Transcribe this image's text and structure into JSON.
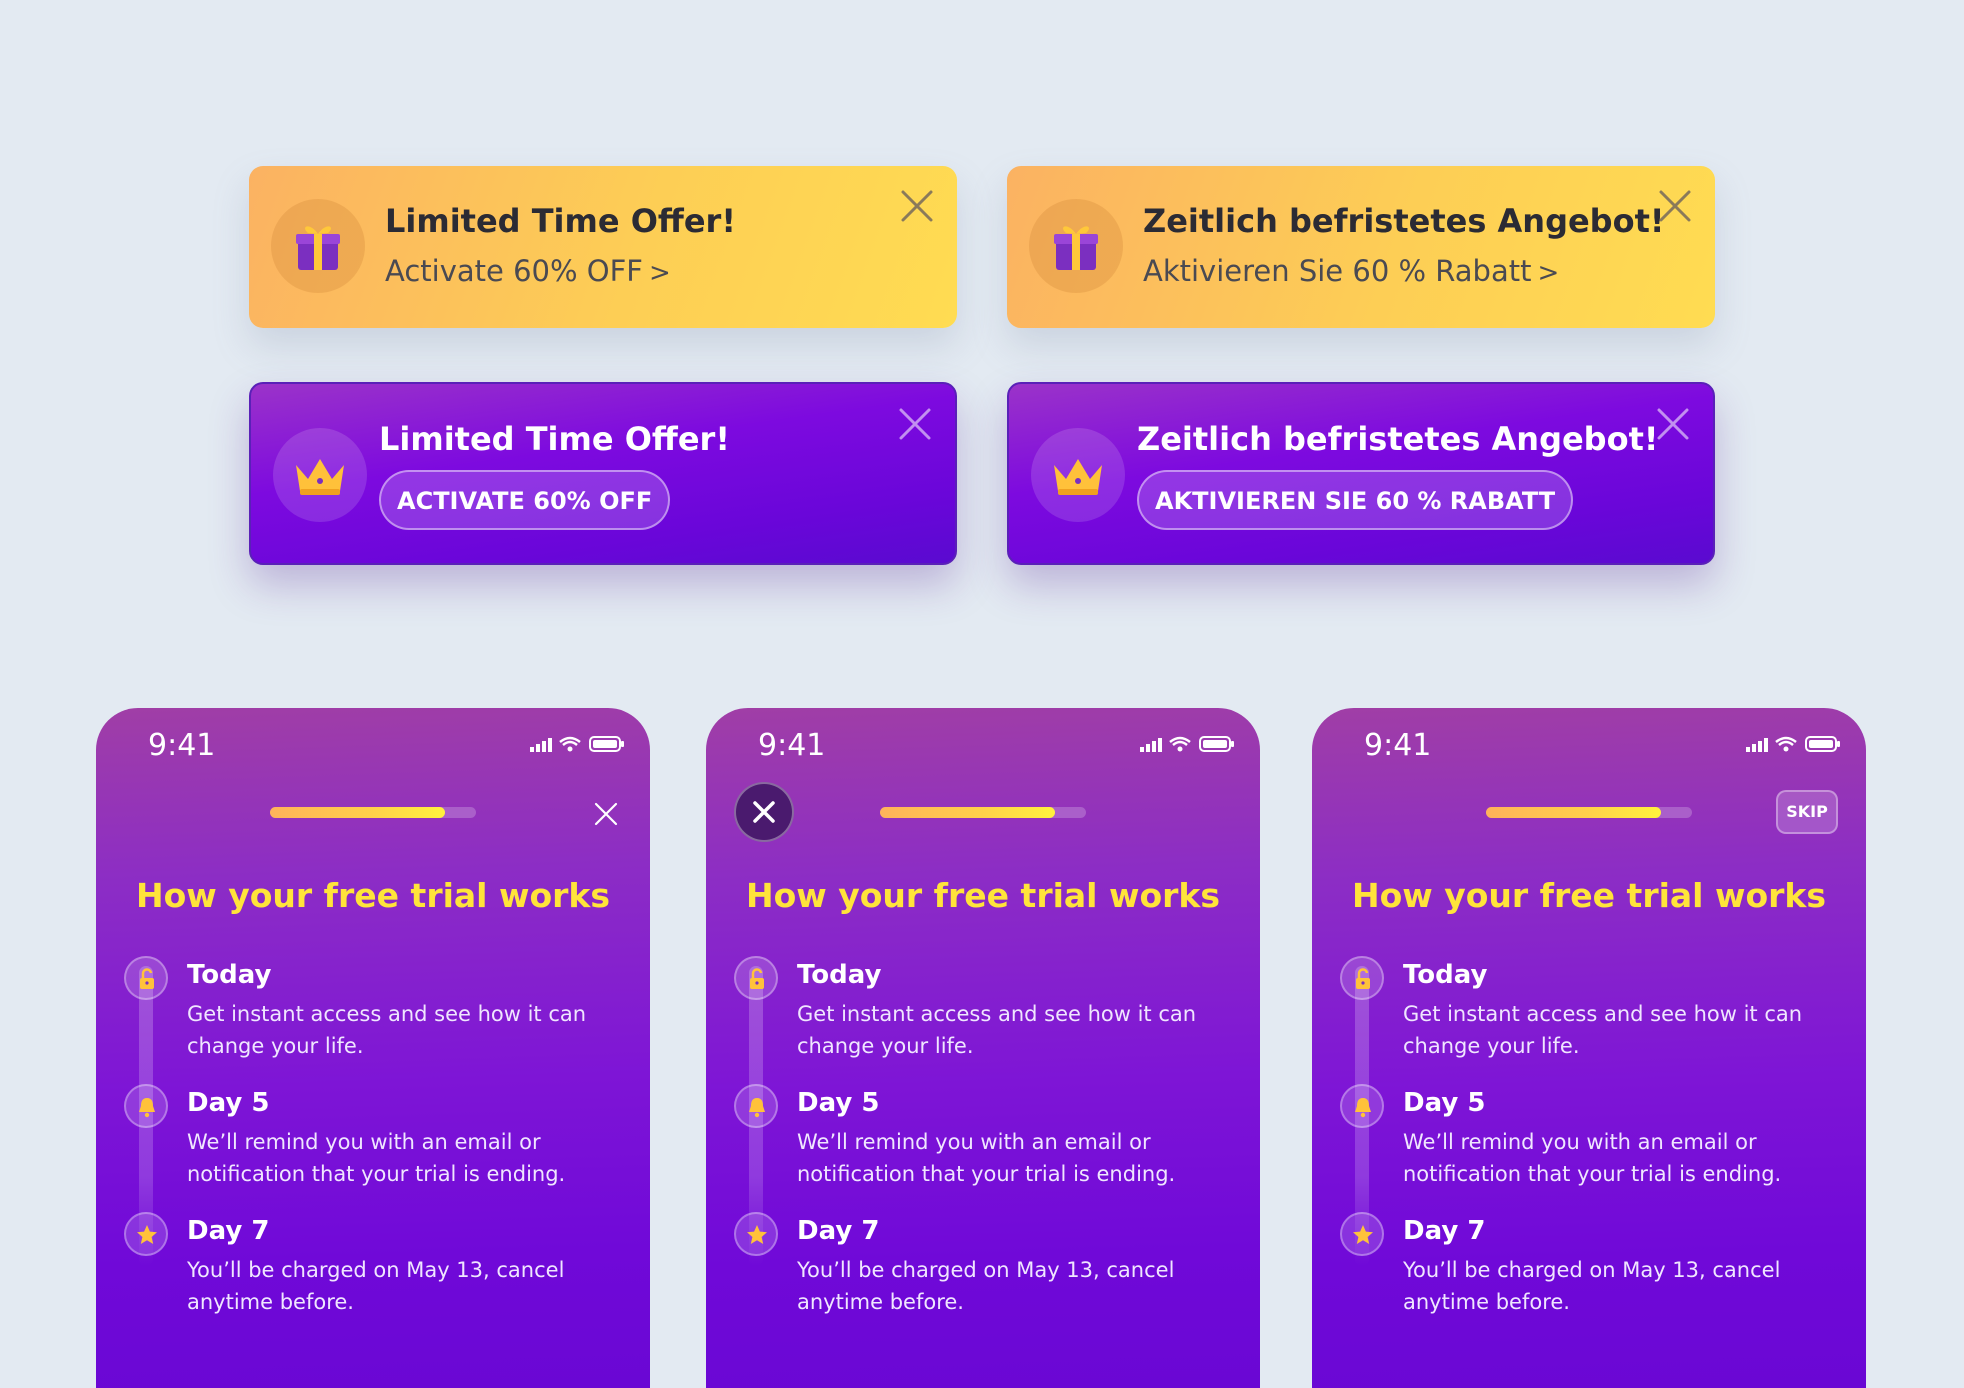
{
  "banners": [
    {
      "title": "Limited Time Offer!",
      "action": "Activate 60% OFF",
      "chevron": ">"
    },
    {
      "title": "Zeitlich befristetes Angebot!",
      "action": "Aktivieren Sie 60 % Rabatt",
      "chevron": ">"
    },
    {
      "title": "Limited Time Offer!",
      "action": "ACTIVATE 60% OFF"
    },
    {
      "title": "Zeitlich befristetes Angebot!",
      "action": "AKTIVIEREN SIE 60 % RABATT"
    }
  ],
  "phone": {
    "time": "9:41",
    "progress": 0.85,
    "title": "How your free trial works",
    "skip_label": "SKIP",
    "steps": [
      {
        "title": "Today",
        "desc": "Get instant access and see how it can change your life.",
        "icon": "unlock-icon"
      },
      {
        "title": "Day 5",
        "desc": "We’ll remind you with an email or notification that your trial is ending.",
        "icon": "bell-icon"
      },
      {
        "title": "Day 7",
        "desc": "You’ll be charged on May 13, cancel anytime before.",
        "icon": "star-icon"
      }
    ]
  },
  "colors": {
    "background": "#e3eaf2",
    "yellow_banner_start": "#fbb262",
    "yellow_banner_end": "#ffdc52",
    "purple": "#7009d8",
    "title_yellow": "#ffe43a"
  }
}
